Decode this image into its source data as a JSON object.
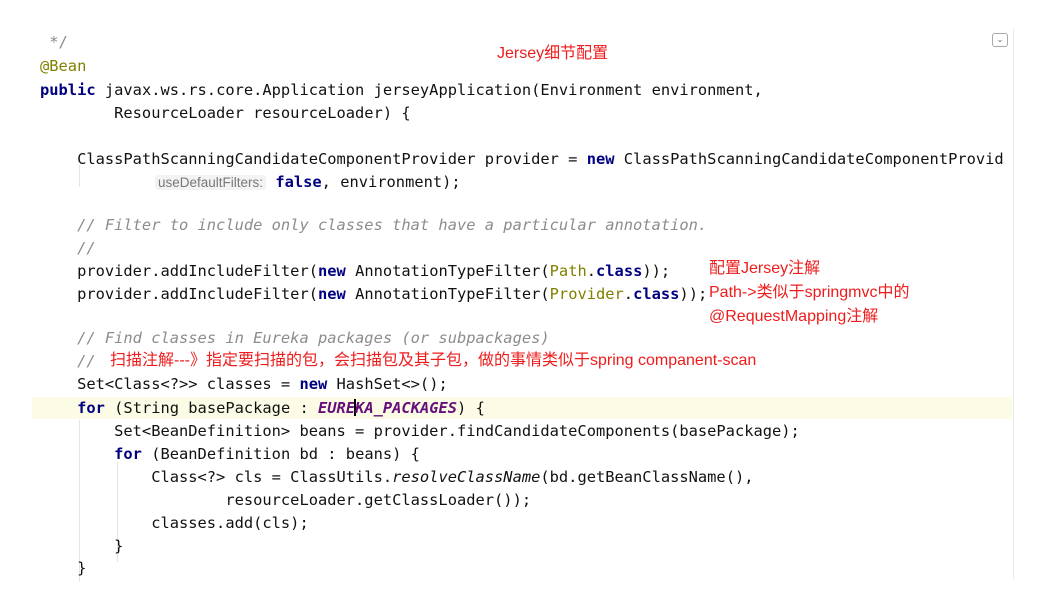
{
  "code": {
    "comment_end": " */",
    "annotation": "@Bean",
    "kw_public": "public",
    "sig_rest": " javax.ws.rs.core.Application jerseyApplication(Environment environment,",
    "sig_line2": "        ResourceLoader resourceLoader) {",
    "provider_pre": "    ClassPathScanningCandidateComponentProvider provider = ",
    "kw_new": "new",
    "provider_post": " ClassPathScanningCandidateComponentProvid",
    "hint_label": "useDefaultFilters:",
    "kw_false": "false",
    "provider_args_end": ", environment);",
    "comment_filter": "    // Filter to include only classes that have a particular annotation.",
    "comment_slashes": "    //",
    "add_filter_pre": "    provider.addIncludeFilter(",
    "atf_mid": " AnnotationTypeFilter(",
    "path_type": "Path",
    "provider_type": "Provider",
    "dot": ".",
    "kw_class": "class",
    "add_filter_end": "));",
    "add_filter_end2": "));",
    "comment_find": "    // Find classes in Eureka packages (or subpackages)",
    "comment_scan_prefix": "    //",
    "set_pre": "    Set<Class<?>> classes = ",
    "set_post": " HashSet<>();",
    "kw_for": "for",
    "for1_pre": " (String basePackage : ",
    "const_a": "EURE",
    "const_b": "KA_PACKAGES",
    "for1_post": ") {",
    "beans_line": "        Set<BeanDefinition> beans = provider.findCandidateComponents(basePackage);",
    "for2_post": " (BeanDefinition bd : beans) {",
    "cls_pre": "            Class<?> cls = ClassUtils.",
    "cls_method": "resolveClassName",
    "cls_post": "(bd.getBeanClassName(),",
    "cls_line2": "                    resourceLoader.getClassLoader());",
    "add_line": "            classes.add(cls);",
    "close_inner": "        }",
    "close_outer": "    }"
  },
  "annotations": {
    "title": "Jersey细节配置",
    "config_annot": "配置Jersey注解",
    "path_note": "Path->类似于springmvc中的",
    "request_mapping": "@RequestMapping注解",
    "scan_note": "扫描注解---》指定要扫描的包，会扫描包及其子包，做的事情类似于spring companent-scan"
  },
  "fold_icon": "chevron-down-icon"
}
